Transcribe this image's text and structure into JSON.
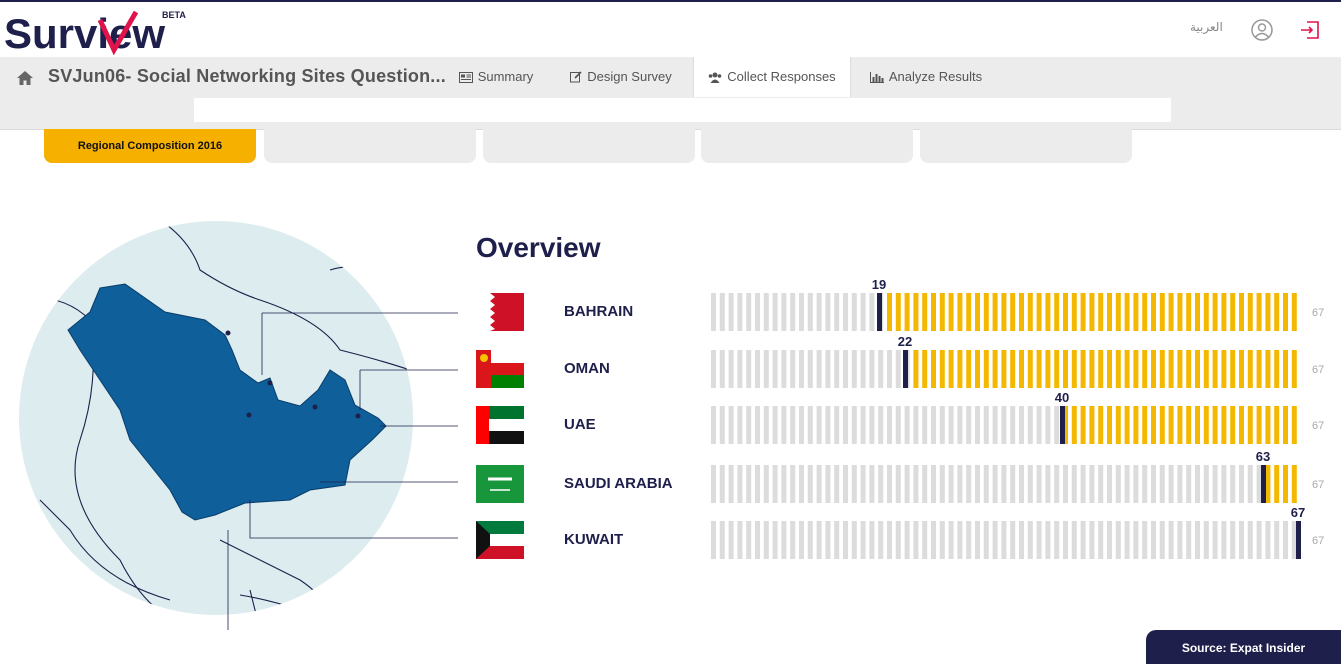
{
  "app": {
    "logo_text": "Surview",
    "logo_badge": "BETA",
    "language_link": "العربية"
  },
  "nav": {
    "survey_title": "SVJun06- Social Networking Sites Question...",
    "tabs": [
      {
        "label": "Summary",
        "icon": "newspaper-icon"
      },
      {
        "label": "Design Survey",
        "icon": "edit-icon"
      },
      {
        "label": "Collect Responses",
        "icon": "users-icon",
        "active": true
      },
      {
        "label": "Analyze Results",
        "icon": "bar-chart-icon"
      }
    ]
  },
  "filter_tabs": [
    {
      "label": "Regional Composition 2016",
      "active": true
    },
    {
      "label": ""
    },
    {
      "label": ""
    },
    {
      "label": ""
    },
    {
      "label": ""
    }
  ],
  "overview": {
    "title": "Overview",
    "max_value": 67,
    "max_label": "67",
    "colors": {
      "filled": "#f5b800",
      "empty": "#dcdcdc",
      "marker": "#1e1f4a"
    },
    "rows": [
      {
        "country": "BAHRAIN",
        "value": 19,
        "label": "19",
        "flag": "bahrain-flag"
      },
      {
        "country": "OMAN",
        "value": 22,
        "label": "22",
        "flag": "oman-flag"
      },
      {
        "country": "UAE",
        "value": 40,
        "label": "40",
        "flag": "uae-flag"
      },
      {
        "country": "SAUDI ARABIA",
        "value": 63,
        "label": "63",
        "flag": "saudi-flag"
      },
      {
        "country": "KUWAIT",
        "value": 67,
        "label": "67",
        "flag": "kuwait-flag"
      }
    ]
  },
  "source": "Source: Expat Insider"
}
